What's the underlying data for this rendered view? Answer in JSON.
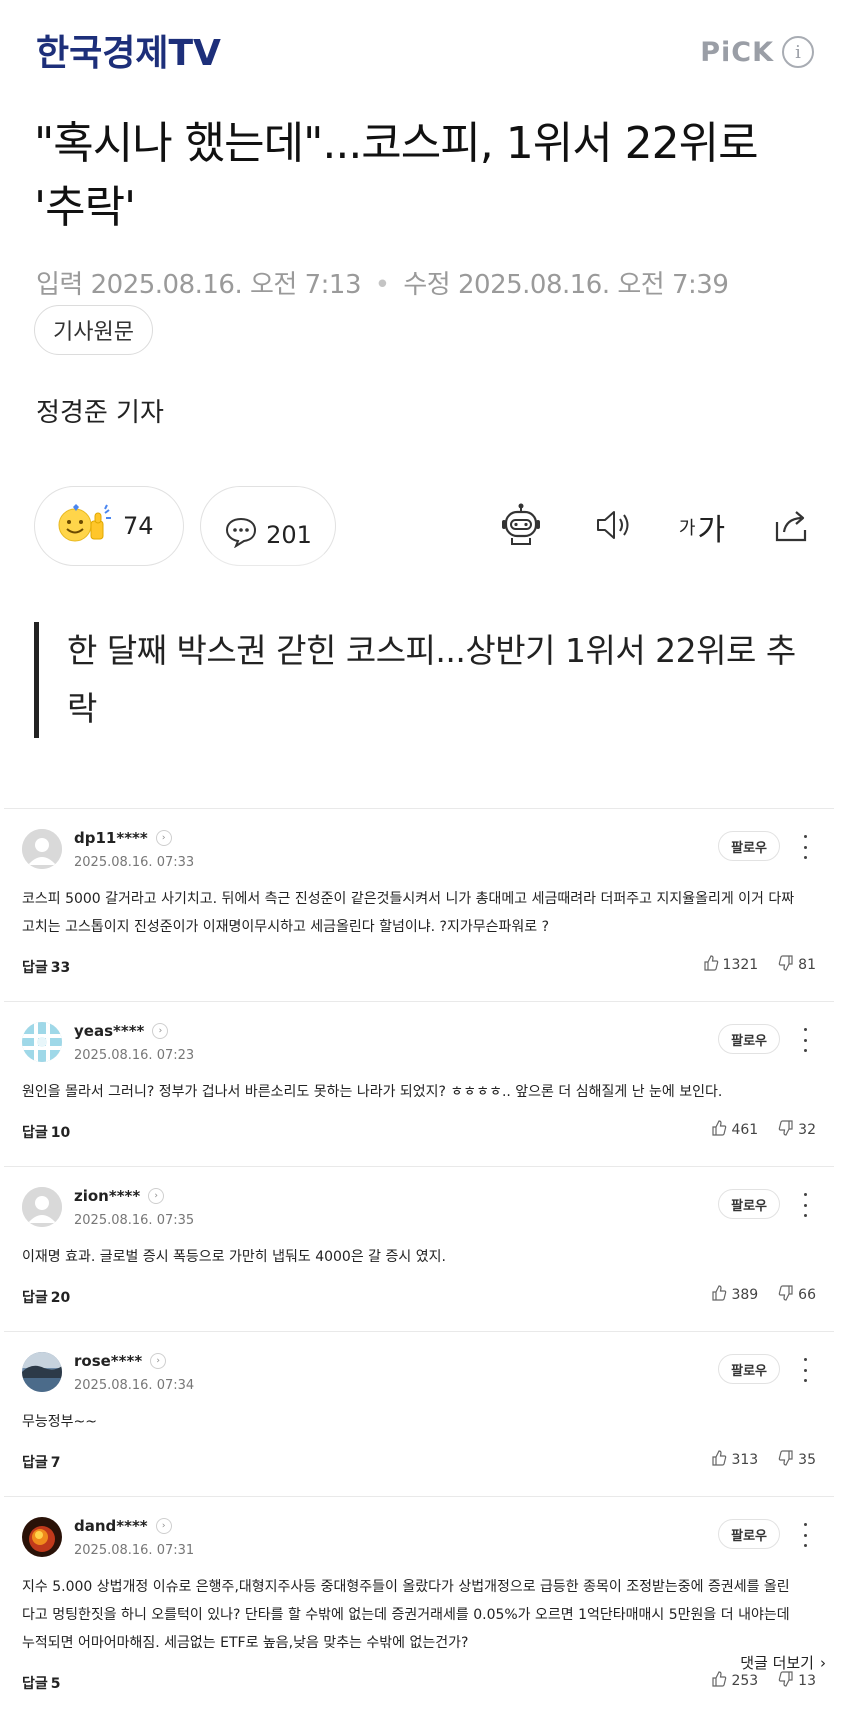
{
  "header": {
    "press_name": "한국경제TV",
    "pick_label": "PiCK",
    "info_symbol": "i",
    "brand_color": "#1d2f7a"
  },
  "article": {
    "title": "\"혹시나 했는데\"...코스피, 1위서 22위로 '추락'",
    "input_label": "입력",
    "input_datetime": "2025.08.16. 오전 7:13",
    "edit_label": "수정",
    "edit_datetime": "2025.08.16. 오전 7:39",
    "original_button": "기사원문",
    "byline": "정경준 기자",
    "reaction_count": "74",
    "comment_count": "201",
    "font_size_small": "가",
    "font_size_large": "가",
    "subheadline": "한 달째 박스권 갇힌 코스피...상반기 1위서 22위로 추락"
  },
  "comments": {
    "follow_label": "팔로우",
    "reply_label": "답글",
    "items": [
      {
        "user": "dp11****",
        "time": "2025.08.16. 07:33",
        "body": "코스피 5000 갈거라고 사기치고. 뒤에서 측근 진성준이 같은것들시켜서 니가 총대메고 세금때려라 더퍼주고 지지율올리게 이거 다짜고치는 고스톱이지 진성준이가 이재명이무시하고 세금올린다 할넘이냐. ?지가무슨파워로 ?",
        "replies": "33",
        "likes": "1321",
        "dislikes": "81",
        "avatar": "default"
      },
      {
        "user": "yeas****",
        "time": "2025.08.16. 07:23",
        "body": "원인을 몰라서 그러니? 정부가 겁나서 바른소리도 못하는 나라가 되었지? ㅎㅎㅎㅎ.. 앞으론 더 심해질게 난 눈에 보인다.",
        "replies": "10",
        "likes": "461",
        "dislikes": "32",
        "avatar": "pattern"
      },
      {
        "user": "zion****",
        "time": "2025.08.16. 07:35",
        "body": "이재명 효과. 글로벌 증시 폭등으로 가만히 냅둬도 4000은 갈 증시 였지.",
        "replies": "20",
        "likes": "389",
        "dislikes": "66",
        "avatar": "default"
      },
      {
        "user": "rose****",
        "time": "2025.08.16. 07:34",
        "body": "무능정부~~",
        "replies": "7",
        "likes": "313",
        "dislikes": "35",
        "avatar": "landscape"
      },
      {
        "user": "dand****",
        "time": "2025.08.16. 07:31",
        "body": "지수 5.000 상법개정 이슈로 은행주,대형지주사등 중대형주들이 올랐다가 상법개정으로 급등한 종목이 조정받는중에 증권세를 올린다고 멍팅한짓을 하니 오를턱이 있나? 단타를 할 수밖에 없는데 증권거래세를 0.05%가 오르면 1억단타매매시 5만원을 더 내야는데 누적되면 어마어마해짐. 세금없는 ETF로 높음,낮음 맞추는 수밖에 없는건가?",
        "replies": "5",
        "likes": "253",
        "dislikes": "13",
        "avatar": "fire"
      }
    ],
    "more_label": "댓글 더보기"
  }
}
